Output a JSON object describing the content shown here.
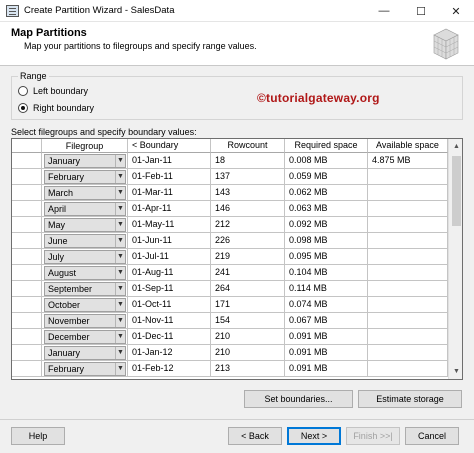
{
  "window": {
    "title": "Create Partition Wizard - SalesData",
    "minimize_glyph": "—",
    "maximize_glyph": "☐",
    "close_glyph": "✕"
  },
  "header": {
    "title": "Map Partitions",
    "subtitle": "Map your partitions to filegroups and specify range values.",
    "icon": "database-partition-icon"
  },
  "range": {
    "legend": "Range",
    "left_label": "Left boundary",
    "right_label": "Right boundary",
    "selected": "right"
  },
  "watermark": "©tutorialgateway.org",
  "grid": {
    "caption": "Select filegroups and specify boundary values:",
    "columns": [
      "Filegroup",
      "< Boundary",
      "Rowcount",
      "Required space",
      "Available space"
    ],
    "rows": [
      {
        "filegroup": "January",
        "boundary": "01-Jan-11",
        "rowcount": "18",
        "required": "0.008 MB",
        "available": "4.875 MB"
      },
      {
        "filegroup": "February",
        "boundary": "01-Feb-11",
        "rowcount": "137",
        "required": "0.059 MB",
        "available": ""
      },
      {
        "filegroup": "March",
        "boundary": "01-Mar-11",
        "rowcount": "143",
        "required": "0.062 MB",
        "available": ""
      },
      {
        "filegroup": "April",
        "boundary": "01-Apr-11",
        "rowcount": "146",
        "required": "0.063 MB",
        "available": ""
      },
      {
        "filegroup": "May",
        "boundary": "01-May-11",
        "rowcount": "212",
        "required": "0.092 MB",
        "available": ""
      },
      {
        "filegroup": "June",
        "boundary": "01-Jun-11",
        "rowcount": "226",
        "required": "0.098 MB",
        "available": ""
      },
      {
        "filegroup": "July",
        "boundary": "01-Jul-11",
        "rowcount": "219",
        "required": "0.095 MB",
        "available": ""
      },
      {
        "filegroup": "August",
        "boundary": "01-Aug-11",
        "rowcount": "241",
        "required": "0.104 MB",
        "available": ""
      },
      {
        "filegroup": "September",
        "boundary": "01-Sep-11",
        "rowcount": "264",
        "required": "0.114 MB",
        "available": ""
      },
      {
        "filegroup": "October",
        "boundary": "01-Oct-11",
        "rowcount": "171",
        "required": "0.074 MB",
        "available": ""
      },
      {
        "filegroup": "November",
        "boundary": "01-Nov-11",
        "rowcount": "154",
        "required": "0.067 MB",
        "available": ""
      },
      {
        "filegroup": "December",
        "boundary": "01-Dec-11",
        "rowcount": "210",
        "required": "0.091 MB",
        "available": ""
      },
      {
        "filegroup": "January",
        "boundary": "01-Jan-12",
        "rowcount": "210",
        "required": "0.091 MB",
        "available": ""
      },
      {
        "filegroup": "February",
        "boundary": "01-Feb-12",
        "rowcount": "213",
        "required": "0.091 MB",
        "available": ""
      }
    ]
  },
  "buttons": {
    "set_boundaries": "Set boundaries...",
    "estimate_storage": "Estimate storage",
    "help": "Help",
    "back": "< Back",
    "next": "Next >",
    "finish": "Finish >>|",
    "cancel": "Cancel"
  }
}
